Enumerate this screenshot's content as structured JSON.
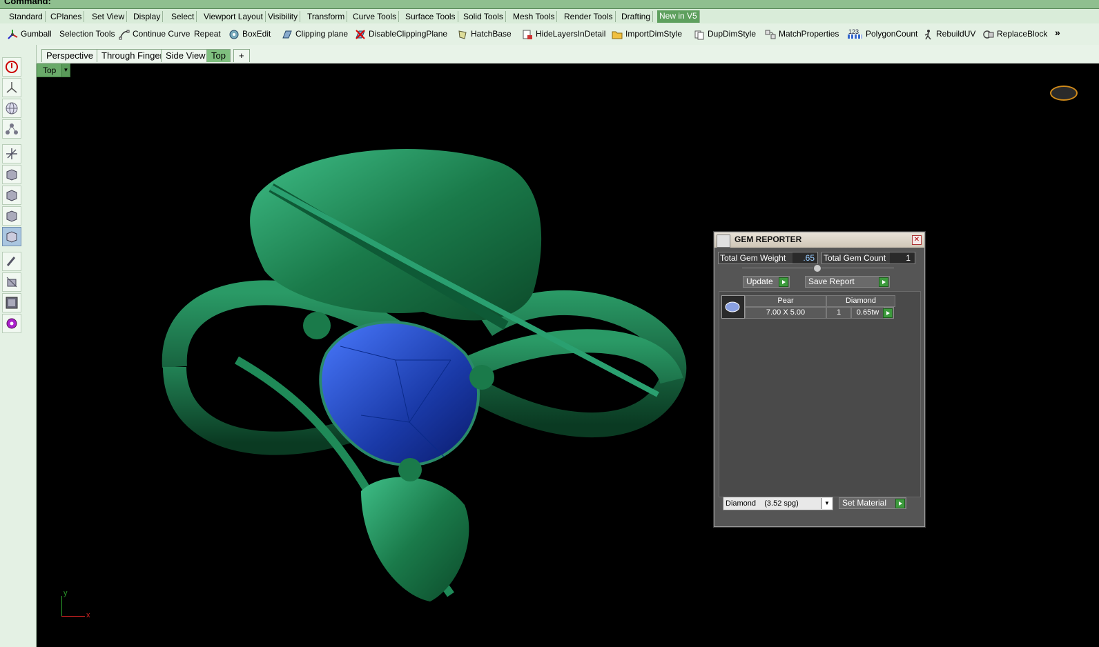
{
  "command": {
    "label": "Command:"
  },
  "menu_tabs": [
    "Standard",
    "CPlanes",
    "Set View",
    "Display",
    "Select",
    "Viewport Layout",
    "Visibility",
    "Transform",
    "Curve Tools",
    "Surface Tools",
    "Solid Tools",
    "Mesh Tools",
    "Render Tools",
    "Drafting",
    "New in V5"
  ],
  "active_menu_tab": "New in V5",
  "toolbar": {
    "items": [
      {
        "label": "Gumball",
        "icon": "gumball-icon"
      },
      {
        "label": "Selection Tools",
        "icon": ""
      },
      {
        "label": "Continue Curve",
        "icon": "continue-curve-icon"
      },
      {
        "label": "Repeat",
        "icon": ""
      },
      {
        "label": "BoxEdit",
        "icon": "boxedit-icon"
      },
      {
        "label": "Clipping plane",
        "icon": "clipping-plane-icon"
      },
      {
        "label": "DisableClippingPlane",
        "icon": "disable-clipping-icon"
      },
      {
        "label": "HatchBase",
        "icon": "hatchbase-icon"
      },
      {
        "label": "HideLayersInDetail",
        "icon": "hide-layers-icon"
      },
      {
        "label": "ImportDimStyle",
        "icon": "folder-icon"
      },
      {
        "label": "DupDimStyle",
        "icon": "dupdimstyle-icon"
      },
      {
        "label": "MatchProperties",
        "icon": "match-properties-icon"
      },
      {
        "label": "PolygonCount",
        "icon": "polygon-count-icon"
      },
      {
        "label": "RebuildUV",
        "icon": "rebuild-uv-icon"
      },
      {
        "label": "ReplaceBlock",
        "icon": "replace-block-icon"
      }
    ],
    "overflow": "»",
    "polygon_count_badge": "123"
  },
  "viewport_tabs": [
    "Perspective",
    "Through Finger",
    "Side View",
    "Top"
  ],
  "active_viewport_tab": "Top",
  "viewport_add": "+",
  "viewport": {
    "label": "Top",
    "axis_y": "y",
    "axis_x": "x"
  },
  "gem_reporter": {
    "title": "GEM REPORTER",
    "total_weight_label": "Total Gem Weight",
    "total_weight_value": ".65",
    "total_count_label": "Total Gem Count",
    "total_count_value": "1",
    "update_label": "Update",
    "save_report_label": "Save Report",
    "row": {
      "shape": "Pear",
      "material": "Diamond",
      "size": "7.00 X 5.00",
      "count": "1",
      "weight": "0.65tw"
    },
    "material_select": "Diamond    (3.52 spg)",
    "set_material_label": "Set Material"
  },
  "colors": {
    "model_green": "#1e7a4e",
    "gem_blue": "#1c3fa8",
    "toolbar_bg": "#e4f1e4",
    "tab_active": "#5ea05e"
  }
}
